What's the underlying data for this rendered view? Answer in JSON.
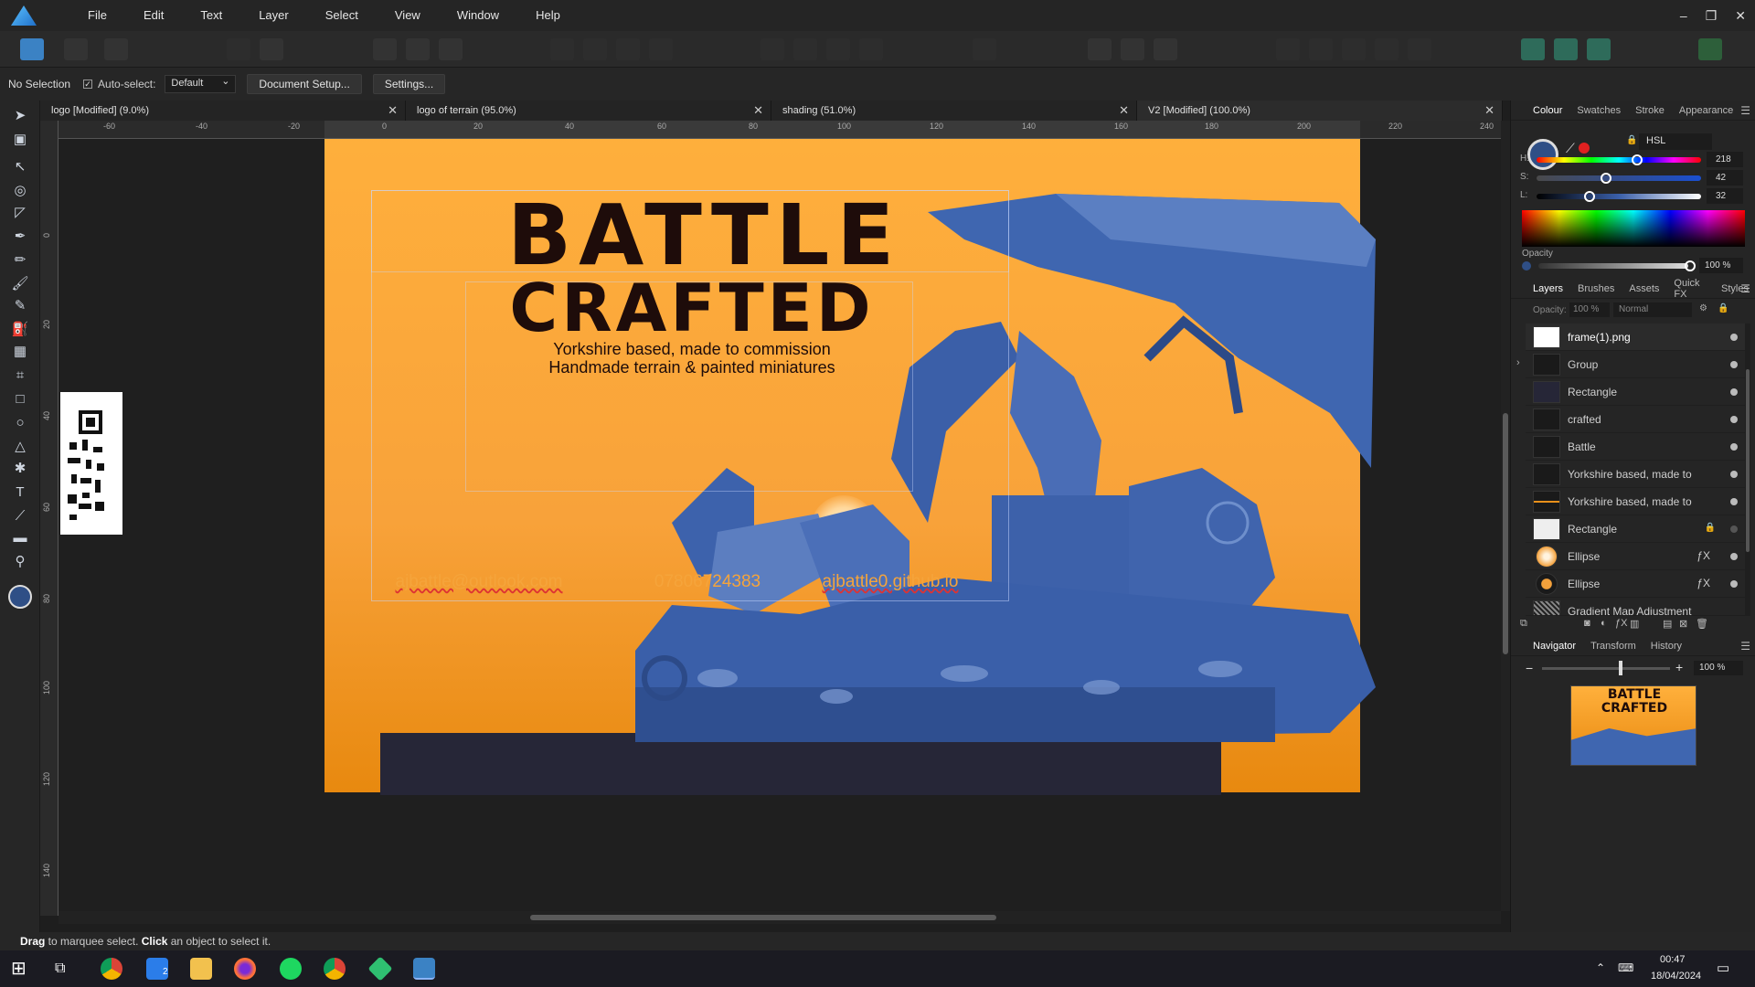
{
  "menu": [
    "File",
    "Edit",
    "Text",
    "Layer",
    "Select",
    "View",
    "Window",
    "Help"
  ],
  "window_controls": [
    "–",
    "❐",
    "✕"
  ],
  "context": {
    "selection": "No Selection",
    "autoselect_label": "Auto-select:",
    "autoselect_value": "Default",
    "document_setup": "Document Setup...",
    "settings": "Settings..."
  },
  "tabs": [
    {
      "label": "logo [Modified] (9.0%)"
    },
    {
      "label": "logo of terrain (95.0%)"
    },
    {
      "label": "shading (51.0%)"
    },
    {
      "label": "V2 [Modified] (100.0%)"
    }
  ],
  "ruler_h": [
    "-60",
    "-40",
    "-20",
    "0",
    "20",
    "40",
    "60",
    "80",
    "100",
    "120",
    "140",
    "160",
    "180",
    "200",
    "220",
    "240"
  ],
  "ruler_v": [
    "0",
    "20",
    "40",
    "60",
    "80",
    "100",
    "120",
    "140"
  ],
  "ruler_unit": "mm",
  "artwork": {
    "title1": "BATTLE",
    "title2": "CRAFTED",
    "tagline1": "Yorkshire based, made to commission",
    "tagline2": "Handmade terrain & painted miniatures",
    "email": "ajbattle@outlook.com",
    "phone": "07806724383",
    "web": "ajbattle0.github.io"
  },
  "colour_panel": {
    "tabs": [
      "Colour",
      "Swatches",
      "Stroke",
      "Appearance"
    ],
    "mode": "HSL",
    "h": "218",
    "s": "42",
    "l": "32",
    "h_pct": 0.61,
    "s_pct": 0.42,
    "l_pct": 0.32,
    "opacity_label": "Opacity",
    "opacity": "100 %",
    "h_label": "H:",
    "s_label": "S:",
    "l_label": "L:"
  },
  "layers_panel": {
    "tabs": [
      "Layers",
      "Brushes",
      "Assets",
      "Quick FX",
      "Styles"
    ],
    "opacity_label": "Opacity:",
    "opacity": "100 %",
    "blend": "Normal",
    "layers": [
      {
        "name": "frame(1).png"
      },
      {
        "name": "Group"
      },
      {
        "name": "Rectangle"
      },
      {
        "name": "crafted"
      },
      {
        "name": "Battle"
      },
      {
        "name": "Yorkshire based, made to"
      },
      {
        "name": "Yorkshire based, made to"
      },
      {
        "name": "Rectangle"
      },
      {
        "name": "Ellipse"
      },
      {
        "name": "Ellipse"
      },
      {
        "name": "Gradient Map Adjustment"
      }
    ]
  },
  "navigator_panel": {
    "tabs": [
      "Navigator",
      "Transform",
      "History"
    ],
    "zoom": "100 %",
    "zoom_pct": 0.6
  },
  "status": {
    "drag": "Drag",
    "drag_rest": " to marquee select. ",
    "click": "Click",
    "click_rest": " an object to select it."
  },
  "taskbar": {
    "time": "00:47",
    "date": "18/04/2024",
    "badge": "2"
  },
  "colors": {
    "accent": "#3b82c4",
    "poster_orange": "#f6a23a",
    "poster_blue": "#3f66b0",
    "text_dark": "#1e0c0a",
    "contact": "#f5a43b"
  }
}
